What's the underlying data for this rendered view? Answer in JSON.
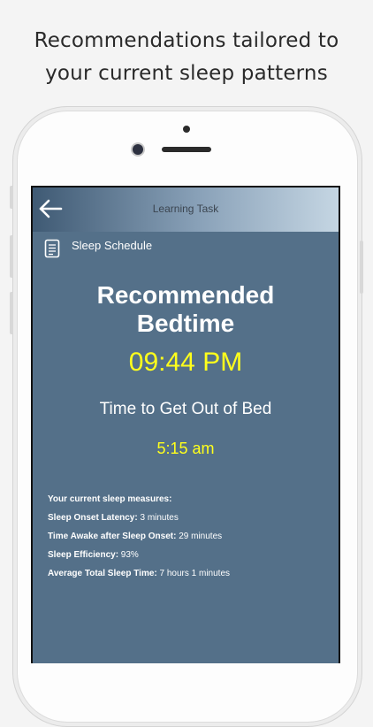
{
  "caption": {
    "line1": "Recommendations tailored to",
    "line2": "your current sleep patterns"
  },
  "navbar": {
    "title": "Learning Task",
    "back_icon": "arrow-left-icon"
  },
  "subheader": {
    "label": "Sleep Schedule",
    "icon": "document-icon"
  },
  "recommendation": {
    "title_line1": "Recommended",
    "title_line2": "Bedtime",
    "bedtime": "09:44 PM",
    "getup_label": "Time to Get Out of Bed",
    "getup_time": "5:15 am"
  },
  "measures": {
    "heading": "Your current sleep measures:",
    "items": [
      {
        "label": "Sleep Onset Latency:",
        "value": " 3 minutes"
      },
      {
        "label": "Time Awake after Sleep Onset:",
        "value": " 29 minutes"
      },
      {
        "label": "Sleep Efficiency:",
        "value": " 93%"
      },
      {
        "label": "Average Total Sleep Time:",
        "value": " 7 hours 1 minutes"
      }
    ]
  },
  "colors": {
    "screen_bg": "#547089",
    "highlight": "#ffff1c",
    "text": "#ffffff"
  }
}
